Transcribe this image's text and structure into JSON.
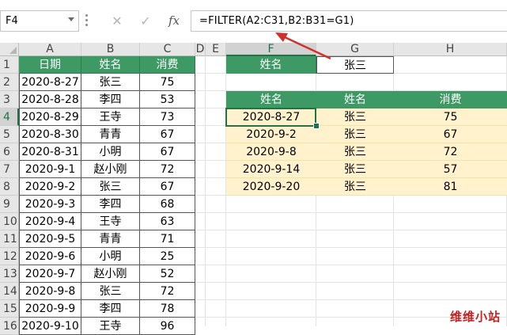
{
  "formula_bar": {
    "name_box": "F4",
    "cancel_icon": "✕",
    "enter_icon": "✓",
    "fx_label": "fx",
    "formula": "=FILTER(A2:C31,B2:B31=G1)"
  },
  "columns": [
    "A",
    "B",
    "C",
    "D",
    "E",
    "F",
    "G",
    "H"
  ],
  "rows": [
    "1",
    "2",
    "3",
    "4",
    "5",
    "6",
    "7",
    "8",
    "9",
    "10",
    "11",
    "12",
    "13",
    "14",
    "15",
    "16"
  ],
  "headers": {
    "date": "日期",
    "name": "姓名",
    "spend": "消费"
  },
  "data_rows": [
    [
      "2020-8-27",
      "张三",
      "75"
    ],
    [
      "2020-8-28",
      "李四",
      "53"
    ],
    [
      "2020-8-29",
      "王寺",
      "73"
    ],
    [
      "2020-8-30",
      "青青",
      "67"
    ],
    [
      "2020-8-31",
      "小明",
      "67"
    ],
    [
      "2020-9-1",
      "赵小刚",
      "72"
    ],
    [
      "2020-9-2",
      "张三",
      "67"
    ],
    [
      "2020-9-3",
      "李四",
      "68"
    ],
    [
      "2020-9-4",
      "王寺",
      "63"
    ],
    [
      "2020-9-5",
      "青青",
      "71"
    ],
    [
      "2020-9-6",
      "小明",
      "25"
    ],
    [
      "2020-9-7",
      "赵小刚",
      "52"
    ],
    [
      "2020-9-8",
      "张三",
      "72"
    ],
    [
      "2020-9-9",
      "李四",
      "78"
    ],
    [
      "2020-9-10",
      "王寺",
      "96"
    ]
  ],
  "criteria": {
    "label": "姓名",
    "value": "张三"
  },
  "result_headers": [
    "姓名",
    "姓名",
    "消费"
  ],
  "result_rows": [
    [
      "2020-8-27",
      "张三",
      "75"
    ],
    [
      "2020-9-2",
      "张三",
      "67"
    ],
    [
      "2020-9-8",
      "张三",
      "72"
    ],
    [
      "2020-9-14",
      "张三",
      "57"
    ],
    [
      "2020-9-20",
      "张三",
      "81"
    ]
  ],
  "watermark": "维维小站",
  "colors": {
    "header_green": "#3d9a64",
    "result_fill": "#fff2cc",
    "arrow": "#d0312d",
    "selection": "#217346"
  }
}
